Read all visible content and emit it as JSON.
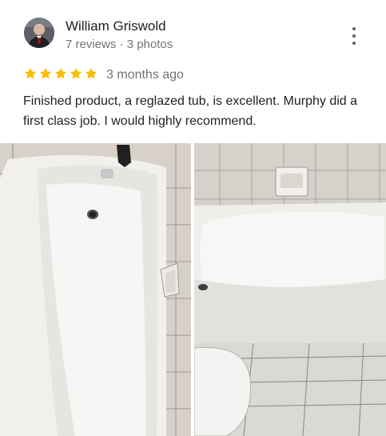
{
  "review": {
    "reviewer_name": "William Griswold",
    "reviewer_meta": "7 reviews · 3 photos",
    "rating": 5,
    "time_ago": "3 months ago",
    "text": "Finished product, a reglazed tub, is excellent. Murphy did a first class job. I would highly recommend.",
    "icons": {
      "menu": "more-vert-icon",
      "star": "star-icon"
    },
    "colors": {
      "star": "#fbbc04",
      "meta_text": "#70757a",
      "primary_text": "#202124"
    }
  }
}
